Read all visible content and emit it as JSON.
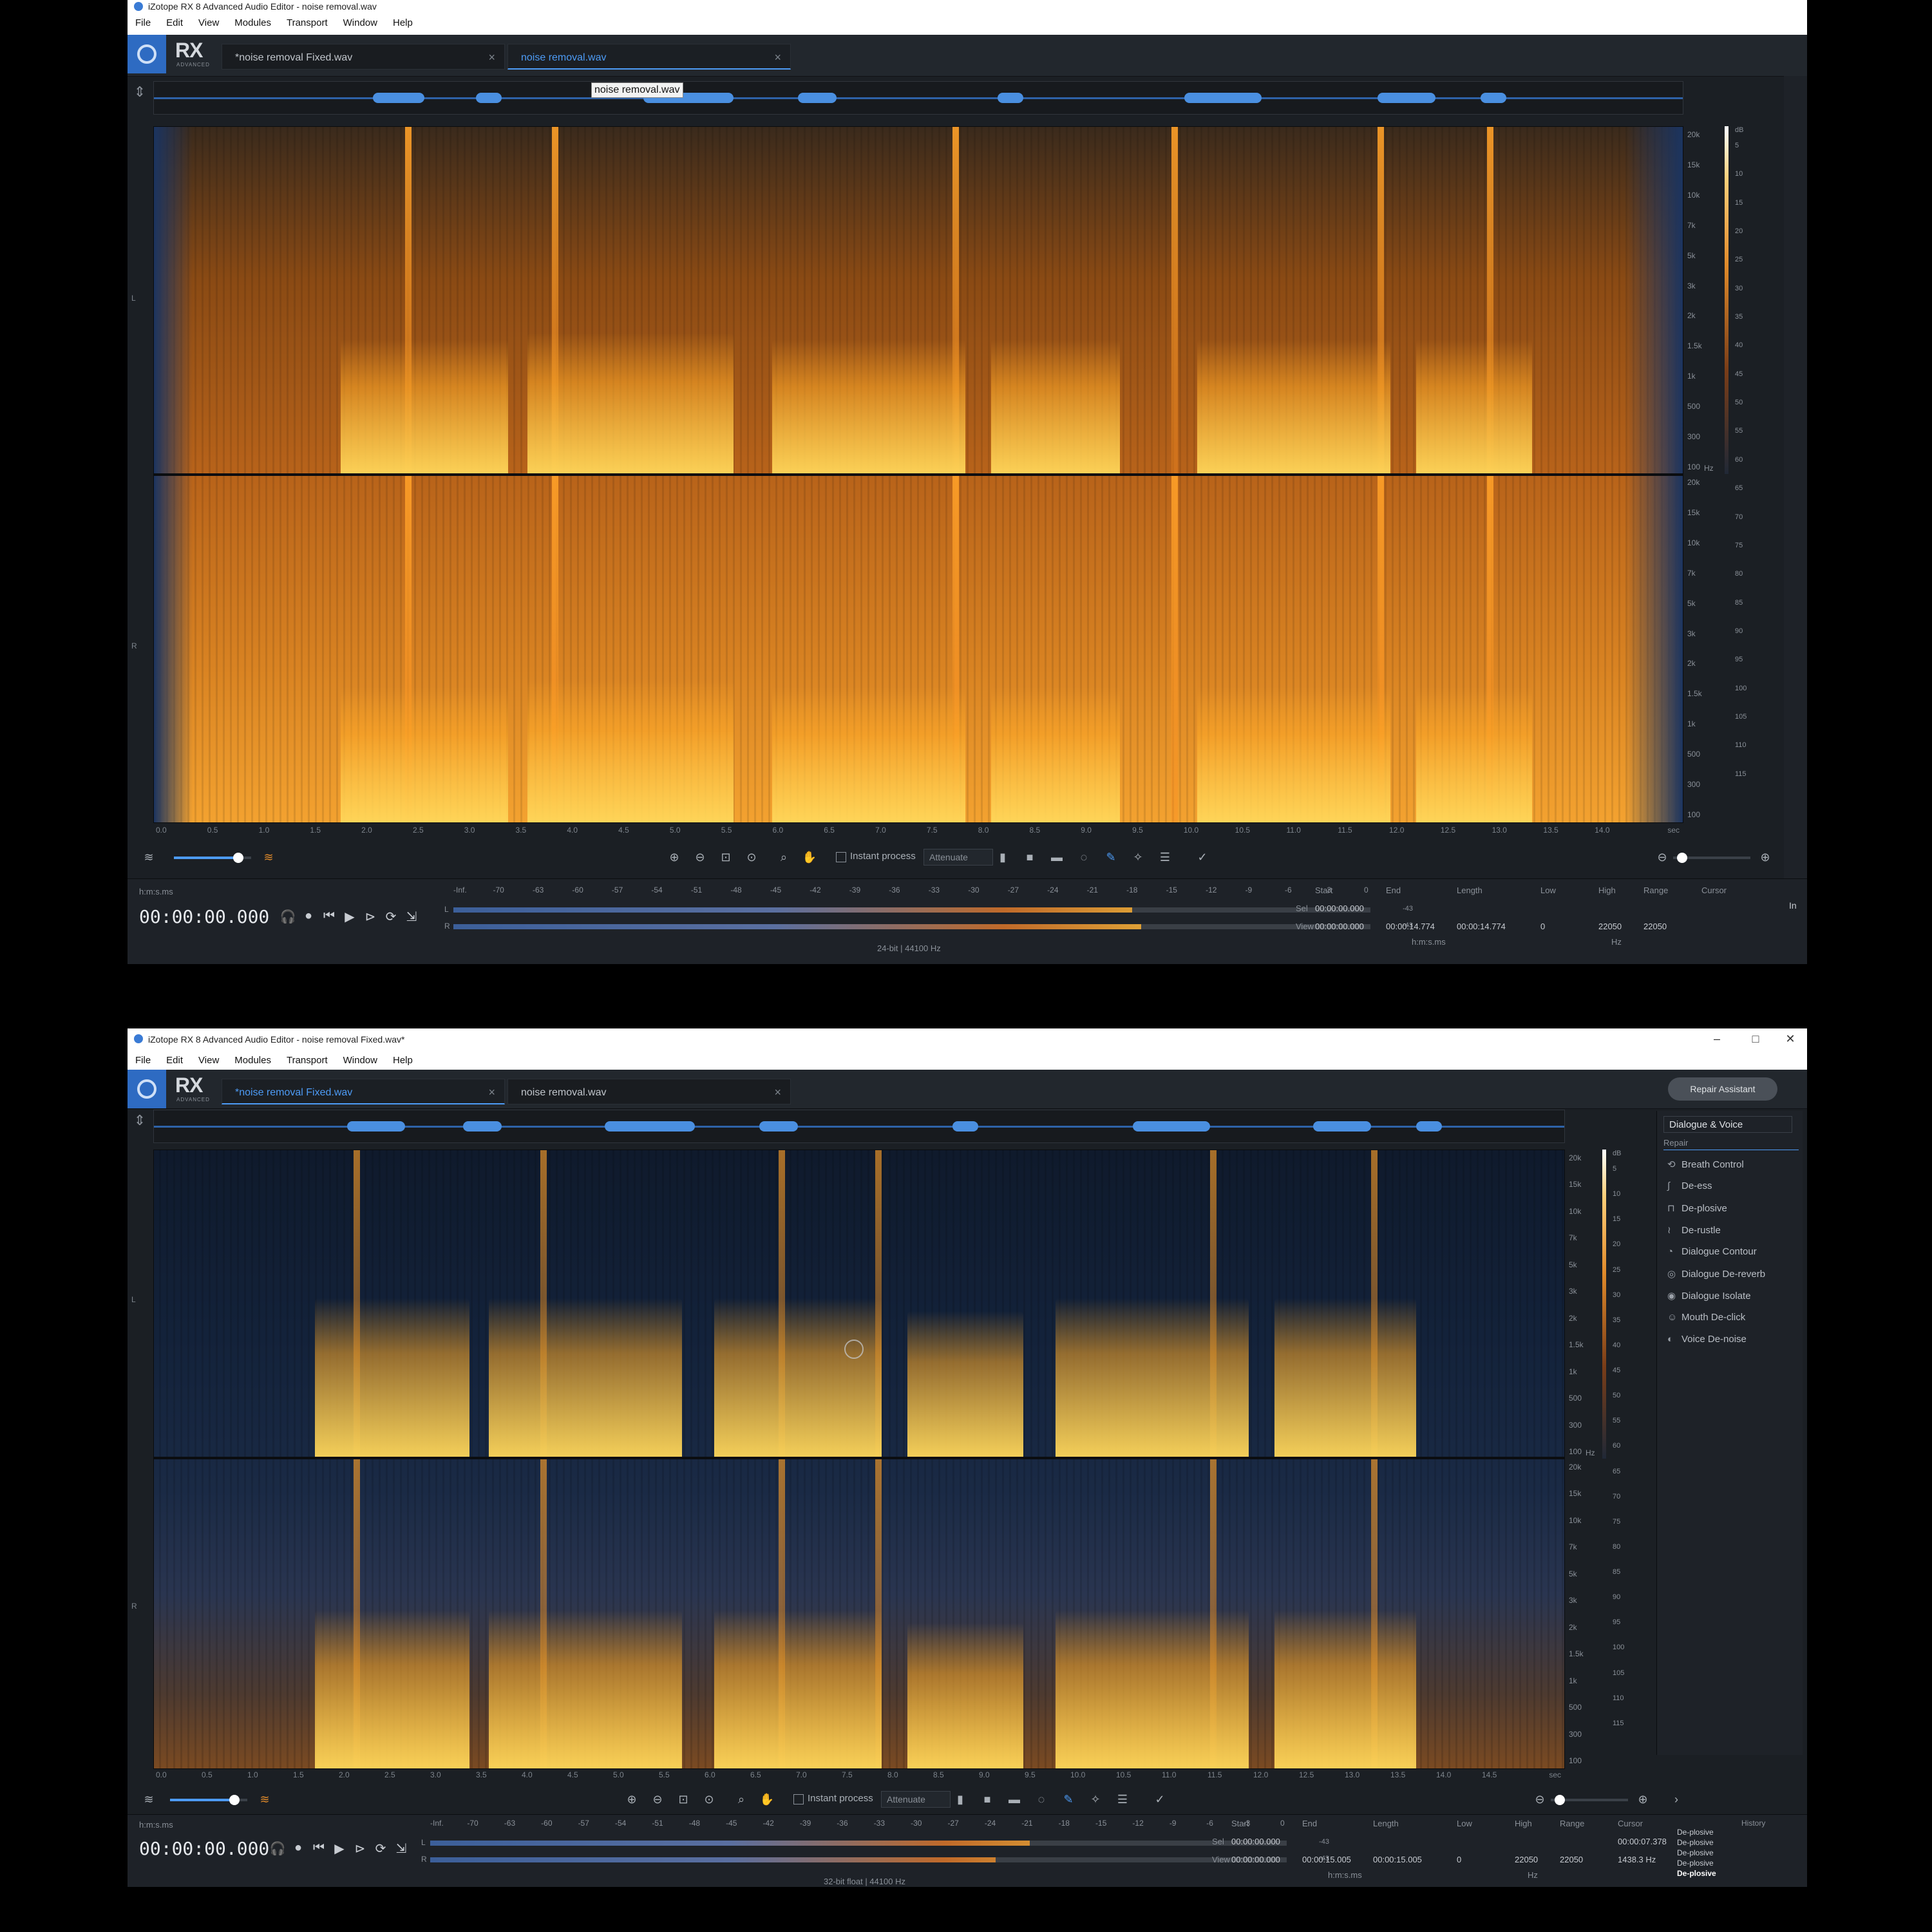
{
  "top": {
    "window_title": "iZotope RX 8 Advanced Audio Editor - noise removal.wav",
    "menus": [
      "File",
      "Edit",
      "View",
      "Modules",
      "Transport",
      "Window",
      "Help"
    ],
    "logo": "RX",
    "logo_sub": "ADVANCED",
    "tabs": [
      {
        "label": "*noise removal Fixed.wav"
      },
      {
        "label": "noise removal.wav"
      }
    ],
    "tab_close": "×",
    "tooltip": "noise removal.wav",
    "channel_labels": [
      "L",
      "R"
    ],
    "freq_ticks": [
      "20k",
      "15k",
      "10k",
      "7k",
      "5k",
      "3k",
      "2k",
      "1.5k",
      "1k",
      "500",
      "300",
      "100"
    ],
    "freq_unit": "Hz",
    "db_unit": "dB",
    "db_ticks": [
      "5",
      "10",
      "15",
      "20",
      "25",
      "30",
      "35",
      "40",
      "45",
      "50",
      "55",
      "60",
      "65",
      "70",
      "75",
      "80",
      "85",
      "90",
      "95",
      "100",
      "105",
      "110",
      "115"
    ],
    "time_ticks": [
      "0.0",
      "0.5",
      "1.0",
      "1.5",
      "2.0",
      "2.5",
      "3.0",
      "3.5",
      "4.0",
      "4.5",
      "5.0",
      "5.5",
      "6.0",
      "6.5",
      "7.0",
      "7.5",
      "8.0",
      "8.5",
      "9.0",
      "9.5",
      "10.0",
      "10.5",
      "11.0",
      "11.5",
      "12.0",
      "12.5",
      "13.0",
      "13.5",
      "14.0"
    ],
    "time_unit": "sec",
    "instant_process": "Instant process",
    "attenuate": "Attenuate",
    "timecode_format": "h:m:s.ms",
    "timecode": "00:00:00.000",
    "meter_scale": [
      "-Inf.",
      "-70",
      "-63",
      "-60",
      "-57",
      "-54",
      "-51",
      "-48",
      "-45",
      "-42",
      "-39",
      "-36",
      "-33",
      "-30",
      "-27",
      "-24",
      "-21",
      "-18",
      "-15",
      "-12",
      "-9",
      "-6",
      "-3",
      "0"
    ],
    "meter_peaks": [
      "-43",
      "-43"
    ],
    "meter_levels": [
      0.74,
      0.75
    ],
    "format": "24-bit | 44100 Hz",
    "info_headers": [
      "Start",
      "End",
      "Length",
      "Low",
      "High",
      "Range",
      "Cursor"
    ],
    "sel_label": "Sel",
    "view_label": "View",
    "sel": {
      "start": "00:00:00.000",
      "end": "",
      "length": ""
    },
    "view": {
      "start": "00:00:00.000",
      "end": "00:00:14.774",
      "length": "00:00:14.774"
    },
    "freq": {
      "low": "0",
      "high": "22050",
      "range": "22050"
    },
    "time_fmt_small": "h:m:s.ms",
    "hz_small": "Hz",
    "right_edge": "In"
  },
  "bottom": {
    "window_title": "iZotope RX 8 Advanced Audio Editor - noise removal Fixed.wav*",
    "menus": [
      "File",
      "Edit",
      "View",
      "Modules",
      "Transport",
      "Window",
      "Help"
    ],
    "logo": "RX",
    "logo_sub": "ADVANCED",
    "tabs": [
      {
        "label": "*noise removal Fixed.wav"
      },
      {
        "label": "noise removal.wav"
      }
    ],
    "tab_close": "×",
    "repair_assistant": "Repair Assistant",
    "channel_labels": [
      "L",
      "R"
    ],
    "freq_ticks": [
      "20k",
      "15k",
      "10k",
      "7k",
      "5k",
      "3k",
      "2k",
      "1.5k",
      "1k",
      "500",
      "300",
      "100"
    ],
    "freq_unit": "Hz",
    "db_unit": "dB",
    "db_ticks": [
      "5",
      "10",
      "15",
      "20",
      "25",
      "30",
      "35",
      "40",
      "45",
      "50",
      "55",
      "60",
      "65",
      "70",
      "75",
      "80",
      "85",
      "90",
      "95",
      "100",
      "105",
      "110",
      "115"
    ],
    "time_ticks": [
      "0.0",
      "0.5",
      "1.0",
      "1.5",
      "2.0",
      "2.5",
      "3.0",
      "3.5",
      "4.0",
      "4.5",
      "5.0",
      "5.5",
      "6.0",
      "6.5",
      "7.0",
      "7.5",
      "8.0",
      "8.5",
      "9.0",
      "9.5",
      "10.0",
      "10.5",
      "11.0",
      "11.5",
      "12.0",
      "12.5",
      "13.0",
      "13.5",
      "14.0",
      "14.5"
    ],
    "time_unit": "sec",
    "instant_process": "Instant process",
    "attenuate": "Attenuate",
    "module_dropdown": "Dialogue & Voice",
    "module_category": "Repair",
    "modules": [
      "Breath Control",
      "De-ess",
      "De-plosive",
      "De-rustle",
      "Dialogue Contour",
      "Dialogue De-reverb",
      "Dialogue Isolate",
      "Mouth De-click",
      "Voice De-noise"
    ],
    "timecode_format": "h:m:s.ms",
    "timecode": "00:00:00.000",
    "meter_scale": [
      "-Inf.",
      "-70",
      "-63",
      "-60",
      "-57",
      "-54",
      "-51",
      "-48",
      "-45",
      "-42",
      "-39",
      "-36",
      "-33",
      "-30",
      "-27",
      "-24",
      "-21",
      "-18",
      "-15",
      "-12",
      "-9",
      "-6",
      "-3",
      "0"
    ],
    "meter_peaks": [
      "-43",
      "-43"
    ],
    "meter_levels": [
      0.7,
      0.66
    ],
    "format": "32-bit float | 44100 Hz",
    "info_headers": [
      "Start",
      "End",
      "Length",
      "Low",
      "High",
      "Range",
      "Cursor"
    ],
    "sel_label": "Sel",
    "view_label": "View",
    "sel": {
      "start": "00:00:00.000",
      "end": "",
      "length": ""
    },
    "view": {
      "start": "00:00:00.000",
      "end": "00:00:15.005",
      "length": "00:00:15.005"
    },
    "freq": {
      "low": "0",
      "high": "22050",
      "range": "22050"
    },
    "cursor": {
      "time": "00:00:07.378",
      "freq": "1438.3 Hz"
    },
    "time_fmt_small": "h:m:s.ms",
    "hz_small": "Hz",
    "history_title": "History",
    "history": [
      "De-plosive",
      "De-plosive",
      "De-plosive",
      "De-plosive",
      "De-plosive"
    ]
  }
}
